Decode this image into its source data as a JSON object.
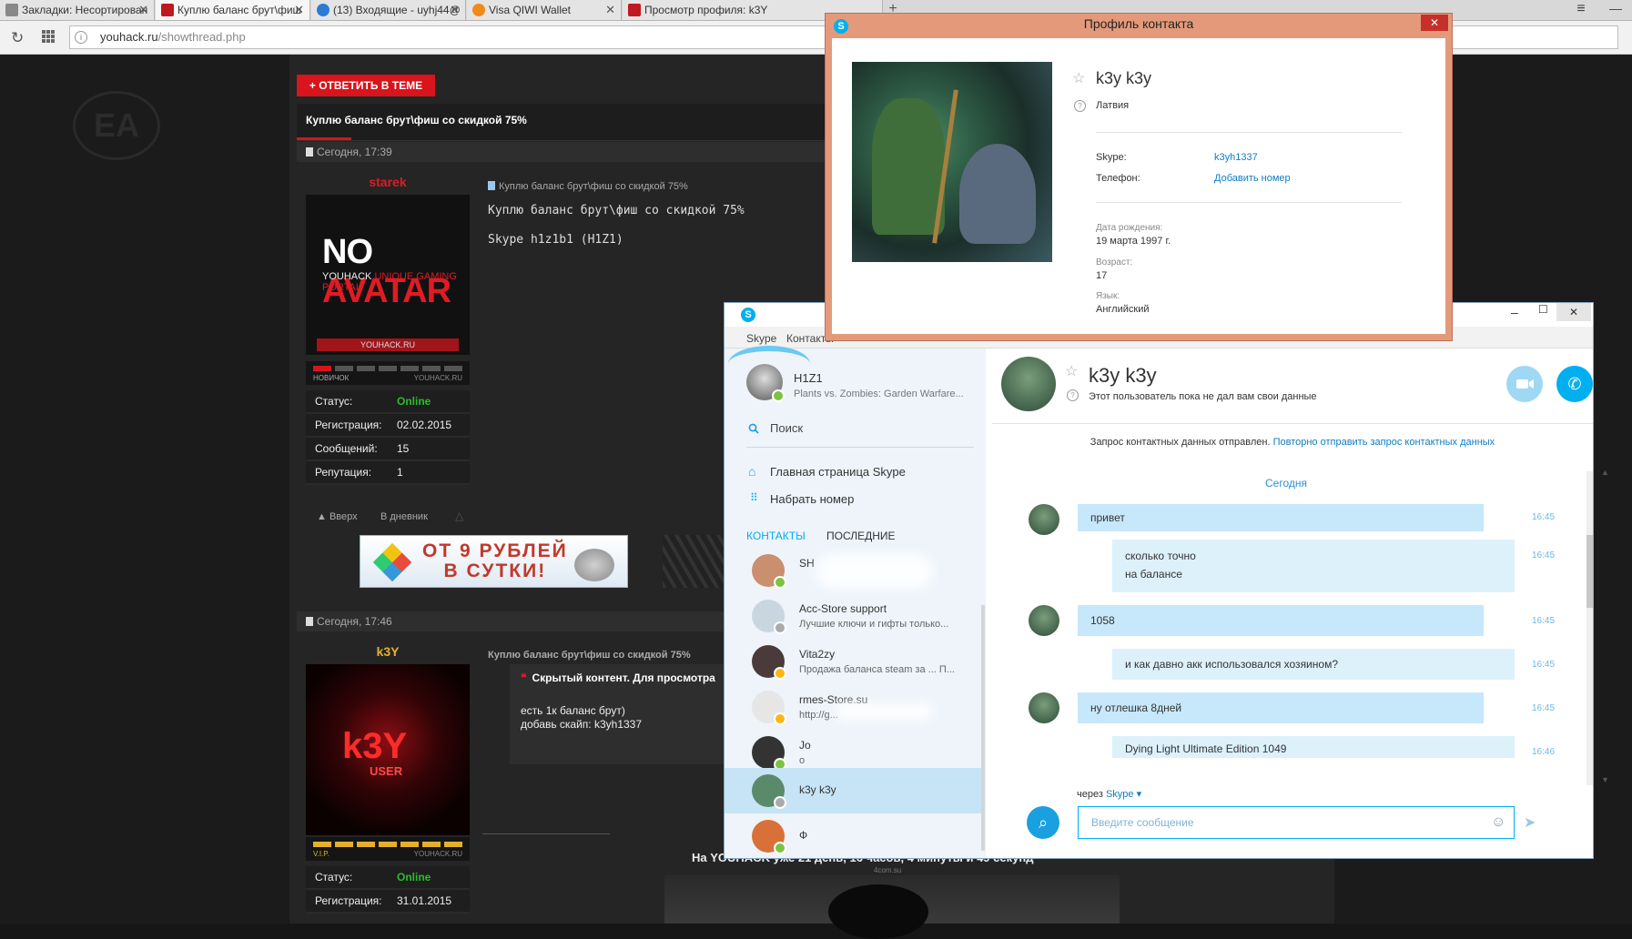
{
  "browser": {
    "tabs": [
      {
        "label": "Закладки: Несортирован",
        "active": false,
        "icon_color": "#888888"
      },
      {
        "label": "Куплю баланс брут\\фиш",
        "active": true,
        "icon_color": "#c0181f"
      },
      {
        "label": "(13) Входящие - uyhj44@",
        "active": false,
        "icon_color": "#2b7bd6"
      },
      {
        "label": "Visa QIWI Wallet",
        "active": false,
        "icon_color": "#f08a1c"
      },
      {
        "label": "Просмотр профиля: k3Y",
        "active": false,
        "icon_color": "#c0181f"
      }
    ],
    "tab_close": "✕",
    "new_tab": "+",
    "url_host": "youhack.ru",
    "url_path": "/showthread.php"
  },
  "forum": {
    "reply_button": "+ ОТВЕТИТЬ В ТЕМЕ",
    "thread_title": "Куплю баланс брут\\фиш со скидкой 75%",
    "posts": [
      {
        "date": "Сегодня, 17:39",
        "username": "starek",
        "avatar": {
          "line1a": "NO",
          "line1b": "AVATAR",
          "line2a": "YOUHACK",
          "line2b": "UNIQUE GAMING PORTAL",
          "band": "YOUHACK.RU"
        },
        "rank": "НОВИЧОК",
        "rank_site": "YOUHACK.RU",
        "stats": [
          {
            "key": "Статус:",
            "value": "Online"
          },
          {
            "key": "Регистрация:",
            "value": "02.02.2015"
          },
          {
            "key": "Сообщений:",
            "value": "15"
          },
          {
            "key": "Репутация:",
            "value": "1"
          }
        ],
        "post_title": "Куплю баланс брут\\фиш со скидкой 75%",
        "body_line1": "Куплю баланс брут\\фиш со скидкой 75%",
        "body_line2": "Skype h1z1b1 (H1Z1)",
        "action_up": "▲ Вверх",
        "action_diary": "В дневник"
      },
      {
        "date": "Сегодня, 17:46",
        "username": "k3Y",
        "avatar": {
          "line1": "k3Y",
          "line2": "USER"
        },
        "rank": "V.I.P.",
        "rank_site": "YOUHACK.RU",
        "stats": [
          {
            "key": "Статус:",
            "value": "Online"
          },
          {
            "key": "Регистрация:",
            "value": "31.01.2015"
          }
        ],
        "post_title": "Куплю баланс брут\\фиш со скидкой 75%",
        "quote_header": "Скрытый контент. Для просмотра",
        "quote_line1": "есть 1к баланс брут)",
        "quote_line2": "добавь скайп: k3yh1337"
      }
    ],
    "banner_line1": "ОТ 9 РУБЛЕЙ",
    "banner_line2": "В СУТКИ!",
    "footer_text": "На YOUHACK уже  21 день, 16 часов, 4 минуты и 49 секунд",
    "footer_sub": "4com.su"
  },
  "skype": {
    "logo": "S",
    "menu": [
      "Skype",
      "Контакты"
    ],
    "me": {
      "name": "H1Z1",
      "mood": "Plants vs. Zombies: Garden Warfare..."
    },
    "search_label": "Поиск",
    "home_link": "Главная страница Skype",
    "dial_link": "Набрать номер",
    "tab_contacts": "КОНТАКТЫ",
    "tab_recent": "ПОСЛЕДНИЕ",
    "contacts": [
      {
        "name": "SH",
        "mood": "",
        "presence": "online",
        "color": "#c98f6e"
      },
      {
        "name": "Acc-Store support",
        "mood": "Лучшие ключи и гифты только...",
        "presence": "online-gray",
        "color": "#c9d6e0"
      },
      {
        "name": "Vita2zy",
        "mood": "Продажа баланса steam за ... П...",
        "presence": "away",
        "color": "#4a3a3a"
      },
      {
        "name": "rmes-Store.su",
        "mood": "http://g...",
        "presence": "away",
        "color": "#e6e6e6"
      },
      {
        "name": "Jo",
        "mood": "o",
        "presence": "online",
        "color": "#333333"
      },
      {
        "name": "k3y k3y",
        "mood": "",
        "presence": "unknown",
        "color": "#5a8a6a",
        "selected": true
      },
      {
        "name": "Ф",
        "mood": "",
        "presence": "online",
        "color": "#d9703a"
      }
    ],
    "chat": {
      "name": "k3y k3y",
      "status": "Этот пользователь пока не дал вам свои данные",
      "notice": "Запрос контактных данных отправлен.",
      "notice_link": "Повторно отправить запрос контактных данных",
      "today": "Сегодня",
      "messages": [
        {
          "lines": [
            "привет"
          ],
          "time": "16:45",
          "mine": false
        },
        {
          "lines": [
            "сколько точно",
            "на балансе"
          ],
          "time": "16:45",
          "mine": true
        },
        {
          "lines": [
            "1058"
          ],
          "time": "16:45",
          "mine": false
        },
        {
          "lines": [
            "и как давно акк использовался хозяином?"
          ],
          "time": "16:45",
          "mine": true
        },
        {
          "lines": [
            "ну отлешка 8дней"
          ],
          "time": "16:45",
          "mine": false
        },
        {
          "lines": [
            "Dying Light Ultimate Edition 1049"
          ],
          "time": "16:46",
          "mine": true
        }
      ],
      "via_prefix": "через",
      "via_link": "Skype",
      "input_placeholder": "Введите сообщение"
    }
  },
  "profile_dialog": {
    "title": "Профиль контакта",
    "name": "k3y k3y",
    "country": "Латвия",
    "skype_label": "Skype:",
    "skype_value": "k3yh1337",
    "phone_label": "Телефон:",
    "phone_value": "Добавить номер",
    "birthday_label": "Дата рождения:",
    "birthday_value": "19 марта 1997 г.",
    "age_label": "Возраст:",
    "age_value": "17",
    "lang_label": "Язык:",
    "lang_value": "Английский"
  },
  "colors": {
    "forum_red": "#d8141c",
    "online_green": "#2bbd2b",
    "skype_blue": "#00aff0",
    "profile_border": "#e49a7a"
  }
}
